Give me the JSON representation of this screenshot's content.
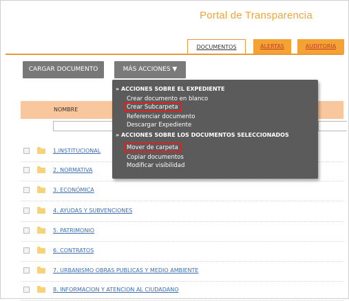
{
  "portal": {
    "title": "Portal de Transparencia"
  },
  "tabs": [
    {
      "label": "DOCUMENTOS"
    },
    {
      "label": "ALERTAS"
    },
    {
      "label": "AUDITORÍA"
    }
  ],
  "toolbar": {
    "upload_label": "CARGAR DOCUMENTO",
    "more_label": "MÁS ACCIONES ▼"
  },
  "table": {
    "column_name": "NOMBRE",
    "rows": [
      {
        "label": "1.INSTITUCIONAL"
      },
      {
        "label": "2. NORMATIVA"
      },
      {
        "label": "3. ECONÓMICA"
      },
      {
        "label": "4. AYUDAS Y SUBVENCIONES"
      },
      {
        "label": "5. PATRIMONIO"
      },
      {
        "label": "6. CONTRATOS"
      },
      {
        "label": "7. URBANISMO OBRAS PUBLICAS Y MEDIO AMBIENTE"
      },
      {
        "label": "8. INFORMACION Y ATENCION AL CIUDADANO"
      }
    ]
  },
  "menu": {
    "section_expediente": "» ACCIONES SOBRE EL EXPEDIENTE",
    "items_expediente": [
      "Crear documento en blanco",
      "Crear Subcarpeta",
      "Referenciar documento",
      "Descargar Expediente"
    ],
    "section_seleccionados": "» ACCIONES SOBRE LOS DOCUMENTOS SELECCIONADOS",
    "items_seleccionados": [
      "Mover de carpeta",
      "Copiar documentos",
      "Modificar visibilidad"
    ]
  },
  "colors": {
    "accent": "#f4a234",
    "highlight": "#e0221f",
    "menu_bg": "#5b5b5b",
    "link": "#3b6db3"
  }
}
